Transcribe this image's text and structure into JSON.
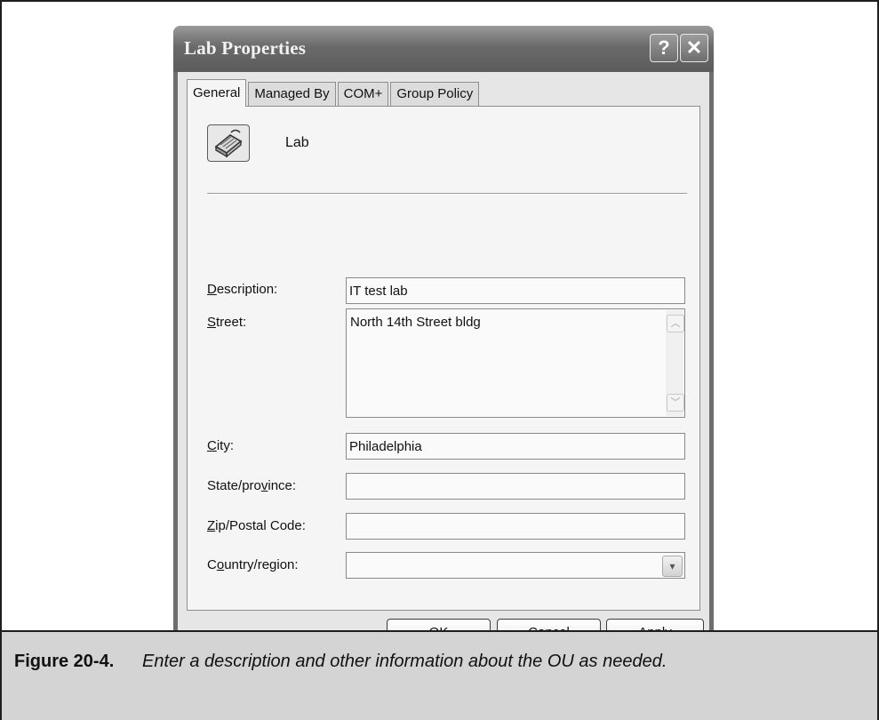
{
  "window": {
    "title": "Lab Properties",
    "help_glyph": "?",
    "close_glyph": "✕"
  },
  "tabs": [
    {
      "label": "General",
      "active": true
    },
    {
      "label": "Managed By",
      "active": false
    },
    {
      "label": "COM+",
      "active": false
    },
    {
      "label": "Group Policy",
      "active": false
    }
  ],
  "general": {
    "object_icon": "organizational-unit-icon",
    "object_name": "Lab",
    "description": {
      "label_hotkey": "D",
      "label_rest": "escription:",
      "value": "IT test lab"
    },
    "street": {
      "label_hotkey": "S",
      "label_rest": "treet:",
      "value": "North 14th Street bldg"
    },
    "city": {
      "label_hotkey": "C",
      "label_rest": "ity:",
      "value": "Philadelphia"
    },
    "state": {
      "label_pre": "State/pro",
      "label_hotkey": "v",
      "label_rest": "ince:",
      "value": ""
    },
    "zip": {
      "label_hotkey": "Z",
      "label_rest": "ip/Postal Code:",
      "value": ""
    },
    "country": {
      "label_pre": "C",
      "label_hotkey": "o",
      "label_rest": "untry/region:",
      "value": ""
    }
  },
  "scrollbar": {
    "up_glyph": "︿",
    "down_glyph": "﹀"
  },
  "dropdown_glyph": "▾",
  "buttons": {
    "ok": "OK",
    "cancel": "Cancel",
    "apply_hotkey": "A",
    "apply_rest": "pply"
  },
  "caption": {
    "label": "Figure 20-4.",
    "text": "Enter a description and other information about the OU as needed."
  }
}
